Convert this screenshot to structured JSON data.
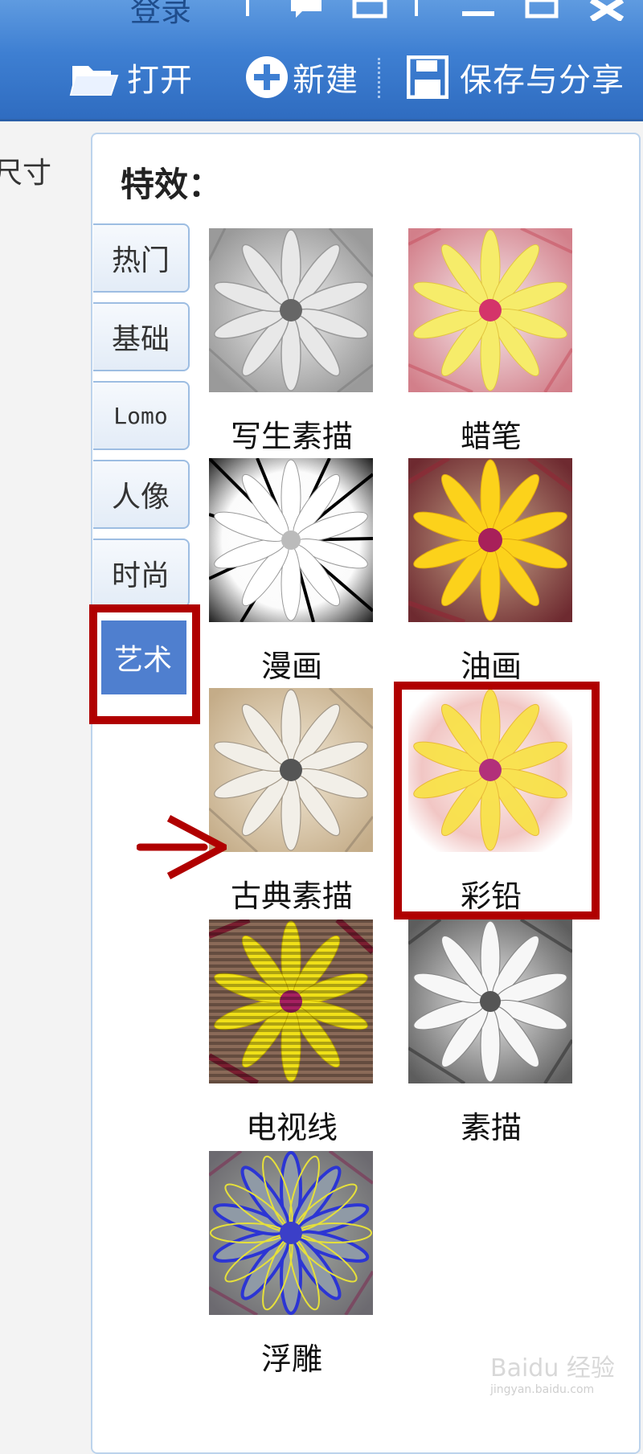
{
  "window": {
    "login": "登录"
  },
  "toolbar": {
    "open": "打开",
    "new": "新建",
    "save_share": "保存与分享"
  },
  "sidebar": {
    "size_label": "尺寸"
  },
  "panel": {
    "title": "特效：",
    "tabs": [
      "热门",
      "基础",
      "Lomo",
      "人像",
      "时尚",
      "艺术"
    ],
    "active_tab": "艺术",
    "effects": [
      "写生素描",
      "蜡笔",
      "漫画",
      "油画",
      "古典素描",
      "彩铅",
      "电视线",
      "素描",
      "浮雕"
    ],
    "highlighted_effect": "彩铅"
  },
  "watermark": {
    "text": "Baidu 经验",
    "sub": "jingyan.baidu.com"
  },
  "colors": {
    "toolbar_blue": "#3e7fd2",
    "active_tab": "#4f7fcf",
    "highlight_red": "#b00000"
  }
}
